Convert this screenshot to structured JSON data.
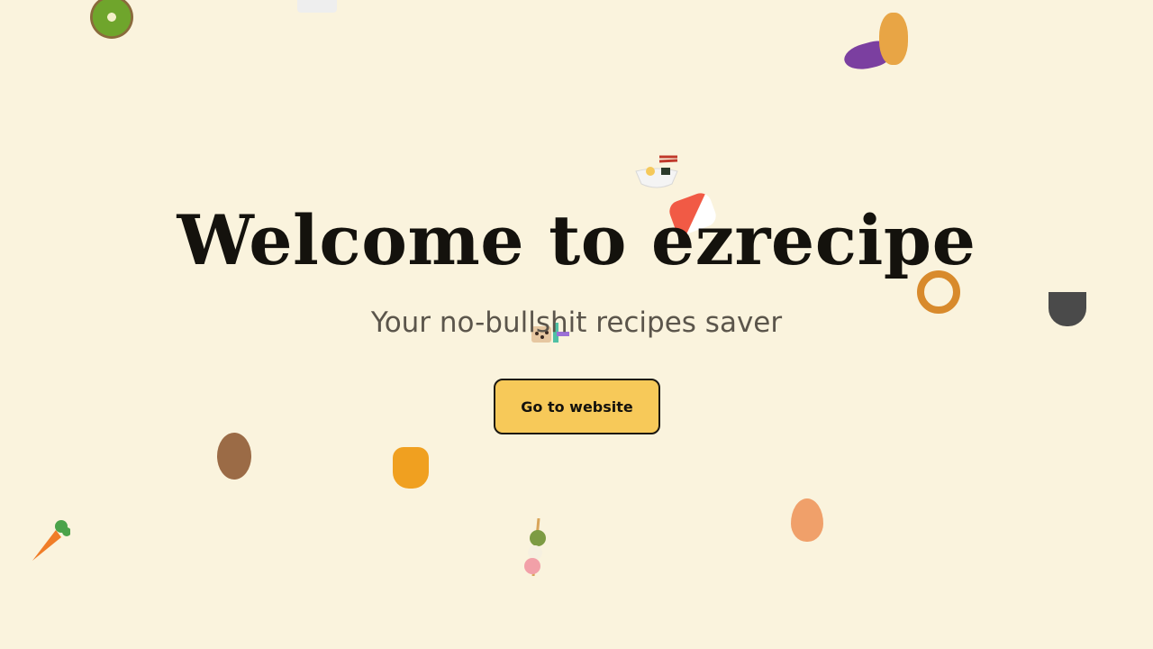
{
  "hero": {
    "title": "Welcome to ezrecipe",
    "subtitle": "Your no-bullshit recipes saver",
    "cta_label": "Go to website"
  },
  "decorations": [
    "kiwi-icon",
    "tofu-icon",
    "eggplant-icon",
    "peanut-icon",
    "ramen-bowl-icon",
    "sushi-icon",
    "pretzel-icon",
    "stew-pot-icon",
    "bubble-tea-icon",
    "potato-icon",
    "honey-pot-icon",
    "carrot-icon",
    "dango-icon",
    "egg-icon"
  ],
  "colors": {
    "background": "#faf3dd",
    "button": "#f7c959",
    "text": "#14120d",
    "subtitle": "#5b554b"
  }
}
